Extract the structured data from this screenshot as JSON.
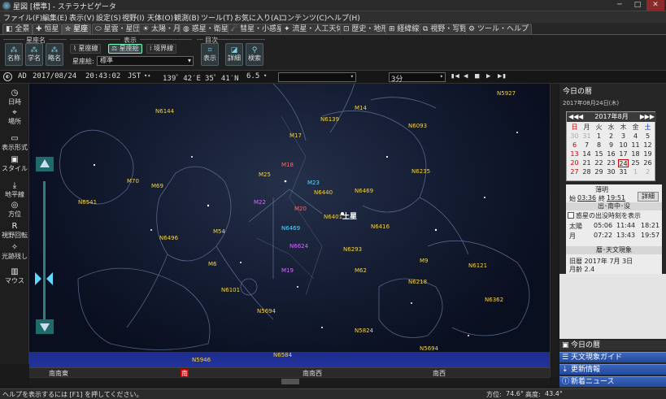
{
  "window": {
    "title": "星図 [標準] - ステラナビゲータ",
    "min": "─",
    "max": "□",
    "close": "✕"
  },
  "menu": [
    "ファイル(F)",
    "編集(E)",
    "表示(V)",
    "設定(S)",
    "視野(I)",
    "天体(O)",
    "観測(B)",
    "ツール(T)",
    "お気に入り(A)",
    "コンテンツ(C)",
    "ヘルプ(H)"
  ],
  "tabs": [
    "全景",
    "恒星",
    "星座",
    "星雲・星団",
    "太陽・月",
    "惑星・衛星",
    "彗星・小惑星",
    "流星・人工天体",
    "歴史・地形",
    "経緯線",
    "視野・写野",
    "ツール・ヘルプ"
  ],
  "ribbon": {
    "group_seizamei": "星座名",
    "btn_name": "名称",
    "btn_gakumei": "学名",
    "btn_ryakumei": "略名",
    "group_hyoji": "表示",
    "btn_seizasen": "星座線",
    "btn_seizae": "星座絵",
    "btn_kyokaisen": "境界線",
    "seizae_label": "星座絵:",
    "seizae_value": "標準",
    "group_mokuji": "目次",
    "btn_hyoji": "表示",
    "btn_shosai": "詳細",
    "btn_kensaku": "検索"
  },
  "datetime": {
    "era": "AD",
    "date": "2017/08/24",
    "time": "20:43:02",
    "tz": "JST",
    "lon": "139゜42′E",
    "lat": "35゜41′N",
    "mag": "6.5",
    "step": "3分"
  },
  "left_tools": [
    "日時",
    "場所",
    "表示形式",
    "スタイル",
    "地平線",
    "方位",
    "視野回転",
    "光跡残し",
    "マウス"
  ],
  "directions": [
    "南南東",
    "南",
    "南南西",
    "南西"
  ],
  "sky_labels": {
    "saturn": "土星",
    "objects": [
      "M4",
      "M7",
      "M8",
      "M16",
      "M17",
      "M18",
      "M20",
      "M21",
      "M22",
      "M23",
      "M24",
      "M25",
      "M28",
      "M54",
      "M55",
      "M62",
      "M69",
      "M70",
      "M75",
      "M80",
      "M107",
      "M10",
      "M12",
      "M14",
      "M9",
      "M19",
      "M6",
      "IC4665",
      "N6544",
      "N6522",
      "N6528",
      "N6624",
      "N6652",
      "N6681",
      "N6626",
      "N6440",
      "N6401",
      "N6426",
      "N6469",
      "N6356",
      "N6342",
      "N6316",
      "N6273",
      "N6284",
      "N6293",
      "N6333",
      "N6355",
      "N6218",
      "N6171",
      "N6144",
      "N6139",
      "N6093",
      "N6121",
      "N6235",
      "N6539",
      "N6517",
      "N6366",
      "N6309",
      "N6325",
      "N6416",
      "N6475",
      "N6405",
      "N6583",
      "N6563",
      "N6818",
      "N6834",
      "N6809",
      "N6864",
      "N6723",
      "N6652",
      "N6544",
      "N6541",
      "N6496",
      "N6453",
      "N6388",
      "N6496",
      "N5986",
      "N6101",
      "N5897",
      "N5694",
      "N5824",
      "N6093",
      "N4593",
      "N6352",
      "N6397",
      "N6362",
      "N5927",
      "N5946",
      "N6584",
      "N6752"
    ]
  },
  "sidebar": {
    "header": "今日の暦",
    "date": "2017年08月24日(木)",
    "month": "2017年8月",
    "weekdays": [
      "日",
      "月",
      "火",
      "水",
      "木",
      "金",
      "土"
    ],
    "days": [
      "30",
      "31",
      "1",
      "2",
      "3",
      "4",
      "5",
      "6",
      "7",
      "8",
      "9",
      "10",
      "11",
      "12",
      "13",
      "14",
      "15",
      "16",
      "17",
      "18",
      "19",
      "20",
      "21",
      "22",
      "23",
      "24",
      "25",
      "26",
      "27",
      "28",
      "29",
      "30",
      "31",
      "1",
      "2"
    ],
    "twilight_title": "薄明",
    "twilight_start_label": "始",
    "twilight_start": "03:36",
    "twilight_end_label": "終",
    "twilight_end": "19:51",
    "detail_button": "詳細",
    "rise_title": "出･南中･没",
    "rise_checkbox": "惑星の出没時刻を表示",
    "sun_label": "太陽",
    "sun_rise": "05:06",
    "sun_transit": "11:44",
    "sun_set": "18:21",
    "moon_label": "月",
    "moon_rise": "07:22",
    "moon_transit": "13:43",
    "moon_set": "19:57",
    "calendar_title": "暦･天文現象",
    "lunar_date": "旧暦 2017年 7月 3日",
    "moon_age": "月齢 2.4",
    "nav": [
      "今日の暦",
      "天文現象ガイド",
      "更新情報",
      "新着ニュース"
    ]
  },
  "status": {
    "hint": "ヘルプを表示するには [F1] を押してください。",
    "azimuth_label": "方位:",
    "azimuth": "74.6°",
    "altitude_label": "高度:",
    "altitude": "43.4°"
  },
  "colors": {
    "accent": "#7fd3e0",
    "label": "#f0d24a",
    "sky": "#141d33",
    "nav": "#234a9a"
  }
}
